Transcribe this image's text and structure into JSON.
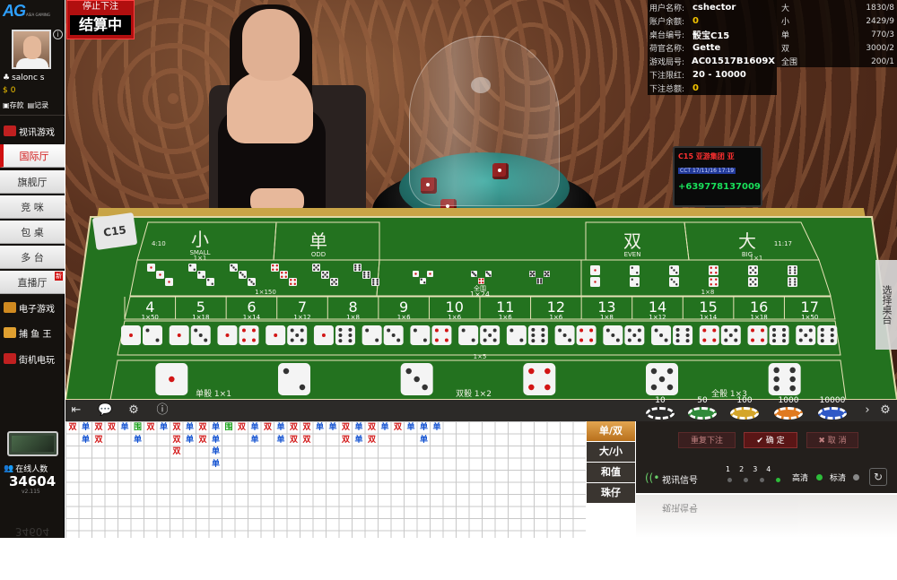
{
  "app": {
    "logo": "AG",
    "logo_sub": "ASIA GAMING",
    "status_top": "停止下注",
    "status_main": "结算中"
  },
  "user": {
    "name": "salonc s",
    "balance": "0",
    "deposit": "存款",
    "records": "记录"
  },
  "sidebar": {
    "video_games": "视讯游戏",
    "halls": [
      "国际厅",
      "旗舰厅",
      "竞 咪",
      "包 桌",
      "多 台",
      "直播厅"
    ],
    "new_badge": "新",
    "electronic": "电子游戏",
    "fishing": "捕 鱼 王",
    "arcade": "街机电玩",
    "online_label": "在线人数",
    "online_count": "34604",
    "version": "v2.115"
  },
  "info": {
    "rows": [
      {
        "label": "用户名称:",
        "value": "cshector"
      },
      {
        "label": "账户余额:",
        "value": "0"
      },
      {
        "label": "桌台编号:",
        "value": "骰宝C15"
      },
      {
        "label": "荷官名称:",
        "value": "Gette"
      },
      {
        "label": "游戏局号:",
        "value": "AC01517B1609X"
      },
      {
        "label": "下注限红:",
        "value": "20 - 10000"
      },
      {
        "label": "下注总额:",
        "value": "0"
      }
    ]
  },
  "stats": [
    {
      "label": "大",
      "value": "1830/8"
    },
    {
      "label": "小",
      "value": "2429/9"
    },
    {
      "label": "单",
      "value": "770/3"
    },
    {
      "label": "双",
      "value": "3000/2"
    },
    {
      "label": "全围",
      "value": "200/1"
    }
  ],
  "monitor": {
    "line1": "C15 亚游集团 亚",
    "line2": "CCT 17/11/16 17:19",
    "line3": "+639778137009"
  },
  "table": {
    "card": "C15",
    "small": {
      "zh": "小",
      "en": "SMALL",
      "range": "4:10",
      "odds": "1×1"
    },
    "odd": {
      "zh": "单",
      "en": "ODD"
    },
    "even": {
      "zh": "双",
      "en": "EVEN"
    },
    "big": {
      "zh": "大",
      "en": "BIG",
      "range": "11:17",
      "odds": "1×1"
    },
    "triples_pay": "1×150",
    "any_triple": "全围",
    "any_triple_pay": "1×24",
    "doubles_pay": "1×8",
    "totals": [
      {
        "n": "4",
        "p": "1×50"
      },
      {
        "n": "5",
        "p": "1×18"
      },
      {
        "n": "6",
        "p": "1×14"
      },
      {
        "n": "7",
        "p": "1×12"
      },
      {
        "n": "8",
        "p": "1×8"
      },
      {
        "n": "9",
        "p": "1×6"
      },
      {
        "n": "10",
        "p": "1×6"
      },
      {
        "n": "11",
        "p": "1×6"
      },
      {
        "n": "12",
        "p": "1×6"
      },
      {
        "n": "13",
        "p": "1×8"
      },
      {
        "n": "14",
        "p": "1×12"
      },
      {
        "n": "15",
        "p": "1×14"
      },
      {
        "n": "16",
        "p": "1×18"
      },
      {
        "n": "17",
        "p": "1×50"
      }
    ],
    "combo_pay": "1×5",
    "single_die": "单骰 1×1",
    "double_die": "双骰 1×2",
    "triple_die": "全骰 1×3"
  },
  "side_tab": "选择桌台",
  "chips": [
    {
      "value": "10",
      "color": "#2a2a2a"
    },
    {
      "value": "50",
      "color": "#2f8a3a"
    },
    {
      "value": "100",
      "color": "#d4a52a"
    },
    {
      "value": "1000",
      "color": "#e07a20"
    },
    {
      "value": "10000",
      "color": "#2f59c6"
    }
  ],
  "roadmap_tabs": [
    "单/双",
    "大/小",
    "和值",
    "珠仔"
  ],
  "roadmap": {
    "columns": [
      [
        "双",
        "",
        "",
        "",
        "",
        "",
        "",
        "",
        ""
      ],
      [
        "单",
        "单",
        "",
        "",
        "",
        "",
        "",
        "",
        ""
      ],
      [
        "双",
        "双",
        "",
        "",
        "",
        "",
        "",
        "",
        ""
      ],
      [
        "双",
        "",
        "",
        "",
        "",
        "",
        "",
        "",
        ""
      ],
      [
        "单",
        "",
        "",
        "",
        "",
        "",
        "",
        "",
        ""
      ],
      [
        "围",
        "单",
        "",
        "",
        "",
        "",
        "",
        "",
        ""
      ],
      [
        "双",
        "",
        "",
        "",
        "",
        "",
        "",
        "",
        ""
      ],
      [
        "单",
        "",
        "",
        "",
        "",
        "",
        "",
        "",
        ""
      ],
      [
        "双",
        "双",
        "双",
        "",
        "",
        "",
        "",
        "",
        ""
      ],
      [
        "单",
        "单",
        "",
        "",
        "",
        "",
        "",
        "",
        ""
      ],
      [
        "双",
        "双",
        "",
        "",
        "",
        "",
        "",
        "",
        ""
      ],
      [
        "单",
        "单",
        "单",
        "单",
        "",
        "",
        "",
        "",
        ""
      ],
      [
        "围",
        "",
        "",
        "",
        "",
        "",
        "",
        "",
        ""
      ],
      [
        "双",
        "",
        "",
        "",
        "",
        "",
        "",
        "",
        ""
      ],
      [
        "单",
        "单",
        "",
        "",
        "",
        "",
        "",
        "",
        ""
      ],
      [
        "双",
        "",
        "",
        "",
        "",
        "",
        "",
        "",
        ""
      ],
      [
        "单",
        "单",
        "",
        "",
        "",
        "",
        "",
        "",
        ""
      ],
      [
        "双",
        "双",
        "",
        "",
        "",
        "",
        "",
        "",
        ""
      ],
      [
        "双",
        "双",
        "",
        "",
        "",
        "",
        "",
        "",
        ""
      ],
      [
        "单",
        "",
        "",
        "",
        "",
        "",
        "",
        "",
        ""
      ],
      [
        "单",
        "",
        "",
        "",
        "",
        "",
        "",
        "",
        ""
      ],
      [
        "双",
        "双",
        "",
        "",
        "",
        "",
        "",
        "",
        ""
      ],
      [
        "单",
        "单",
        "",
        "",
        "",
        "",
        "",
        "",
        ""
      ],
      [
        "双",
        "双",
        "",
        "",
        "",
        "",
        "",
        "",
        ""
      ],
      [
        "单",
        "",
        "",
        "",
        "",
        "",
        "",
        "",
        ""
      ],
      [
        "双",
        "",
        "",
        "",
        "",
        "",
        "",
        "",
        ""
      ],
      [
        "单",
        "",
        "",
        "",
        "",
        "",
        "",
        "",
        ""
      ],
      [
        "单",
        "单",
        "",
        "",
        "",
        "",
        "",
        "",
        ""
      ],
      [
        "单",
        "",
        "",
        "",
        "",
        "",
        "",
        "",
        ""
      ]
    ]
  },
  "controls": {
    "repeat": "重复下注",
    "confirm": "确 定",
    "cancel": "取 消",
    "signal": "视讯信号",
    "signal_levels": [
      "1",
      "2",
      "3",
      "4"
    ],
    "hd": "高清",
    "sd": "标清"
  }
}
